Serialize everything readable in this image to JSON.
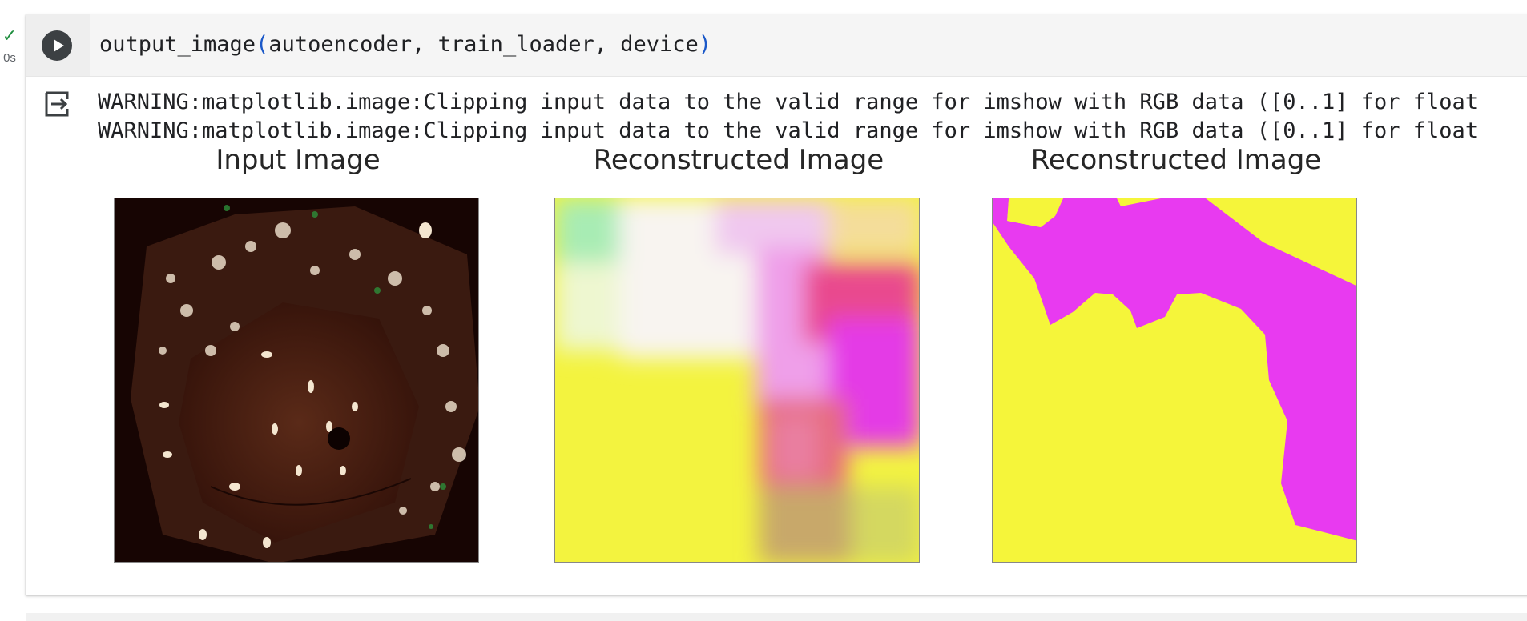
{
  "status": {
    "time": "0s"
  },
  "cell": {
    "function_name": "output_image",
    "open_paren": "(",
    "arguments": "autoencoder, train_loader, device",
    "close_paren": ")"
  },
  "output": {
    "warnings": [
      "WARNING:matplotlib.image:Clipping input data to the valid range for imshow with RGB data ([0..1] for float",
      "WARNING:matplotlib.image:Clipping input data to the valid range for imshow with RGB data ([0..1] for float"
    ],
    "figures": [
      {
        "title": "Input Image"
      },
      {
        "title": "Reconstructed Image"
      },
      {
        "title": "Reconstructed Image"
      }
    ]
  },
  "colors": {
    "magenta": "#e83af0",
    "yellow": "#f5f53a",
    "run_button": "#3c4043",
    "check": "#1e8e3e"
  },
  "icons": [
    "check-icon",
    "play-icon",
    "output-redirect-icon"
  ]
}
